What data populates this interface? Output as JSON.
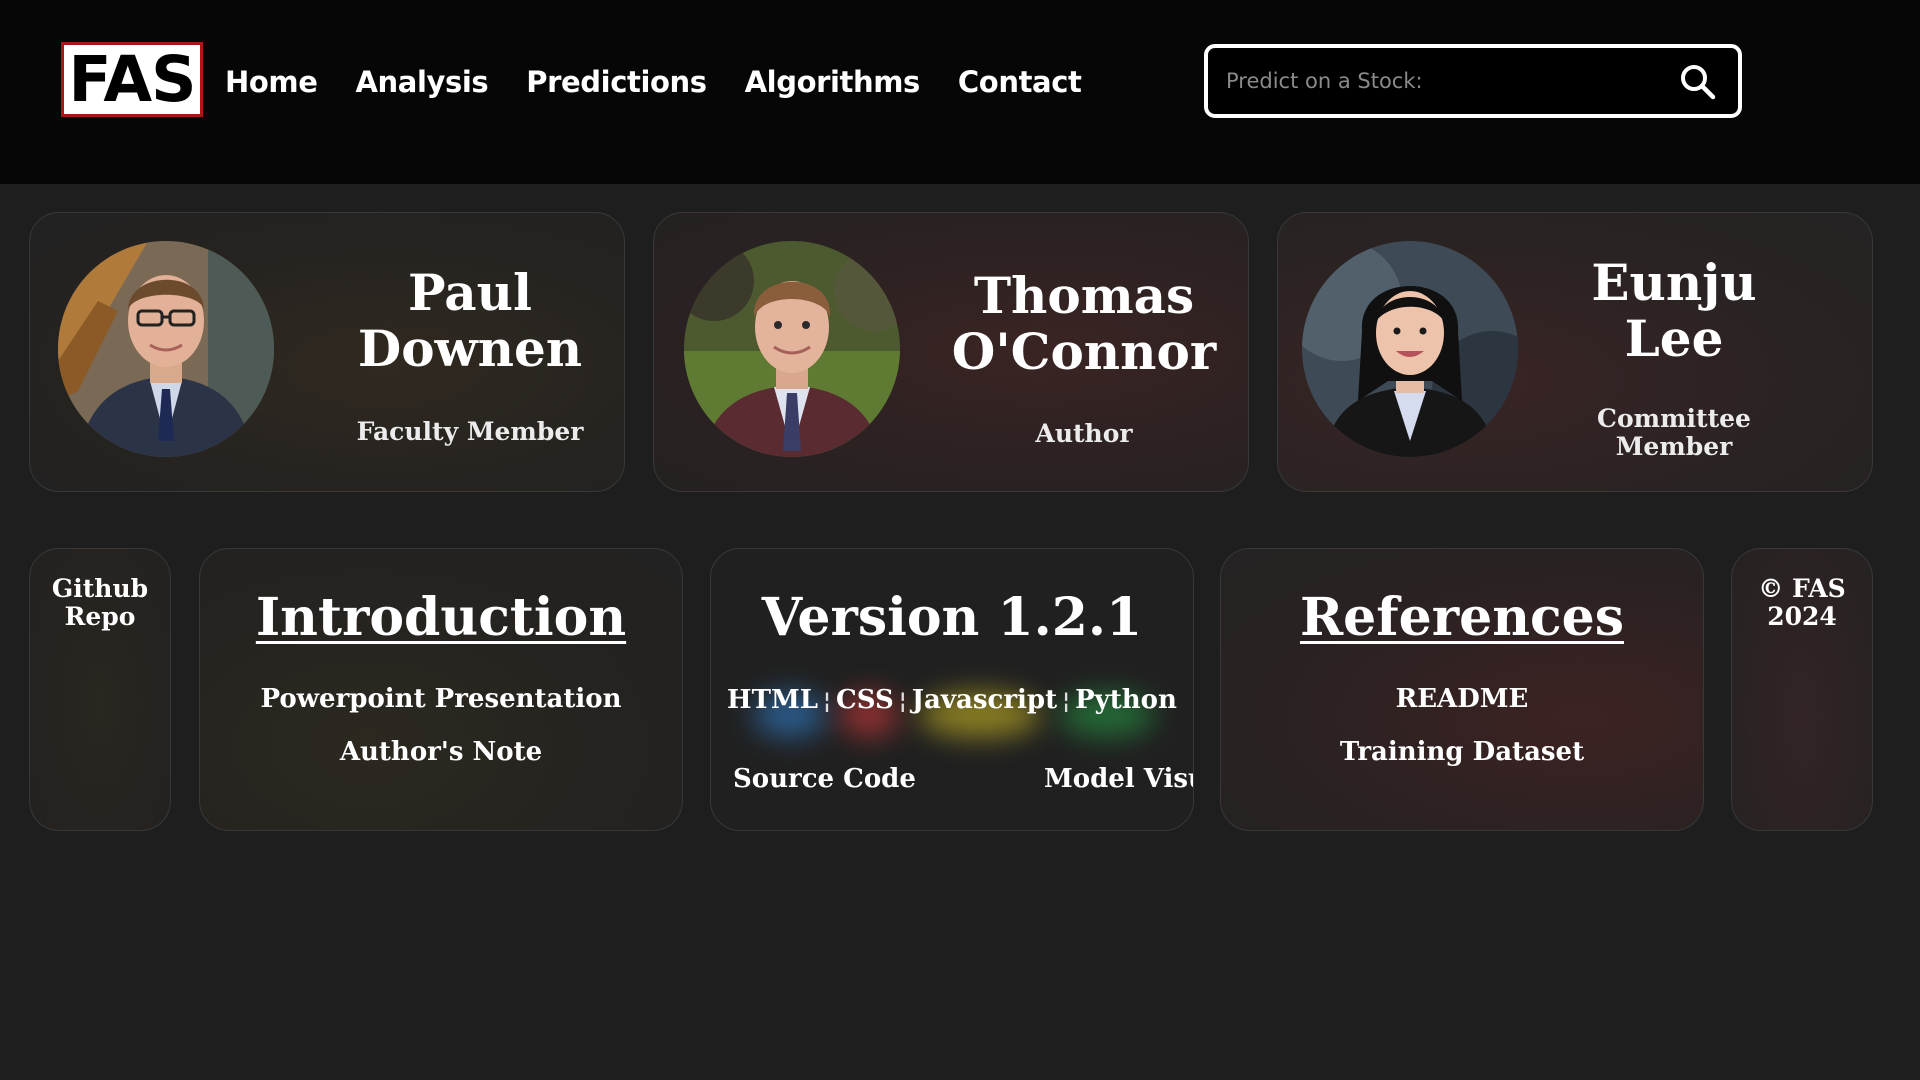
{
  "header": {
    "logo_text": "FAS",
    "nav": [
      "Home",
      "Analysis",
      "Predictions",
      "Algorithms",
      "Contact"
    ],
    "search_placeholder": "Predict on a Stock:",
    "search_icon": "search-icon"
  },
  "people": [
    {
      "name_line1": "Paul",
      "name_line2": "Downen",
      "role": "Faculty Member"
    },
    {
      "name_line1": "Thomas",
      "name_line2": "O'Connor",
      "role": "Author"
    },
    {
      "name_line1": "Eunju",
      "name_line2": "Lee",
      "role_line1": "Committee",
      "role_line2": "Member"
    }
  ],
  "links": {
    "github": {
      "line1": "Github",
      "line2": "Repo"
    },
    "introduction": {
      "title": "Introduction",
      "items": [
        "Powerpoint Presentation",
        "Author's Note"
      ]
    },
    "version": {
      "title": "Version 1.2.1",
      "tech": [
        "HTML",
        "CSS",
        "Javascript",
        "Python"
      ],
      "separator": "¦",
      "left_link": "Source Code",
      "right_link": "Model Visua"
    },
    "references": {
      "title": "References",
      "items": [
        "README",
        "Training Dataset"
      ]
    },
    "copyright": {
      "line1": "© FAS",
      "line2": "2024"
    }
  },
  "colors": {
    "header_bg": "#060606",
    "page_bg": "#1e1e1e",
    "logo_border": "#b01515",
    "glow_html": "#3a7ab8",
    "glow_css": "#c23a3a",
    "glow_js": "#c9b82a",
    "glow_python": "#2e9a4a"
  }
}
